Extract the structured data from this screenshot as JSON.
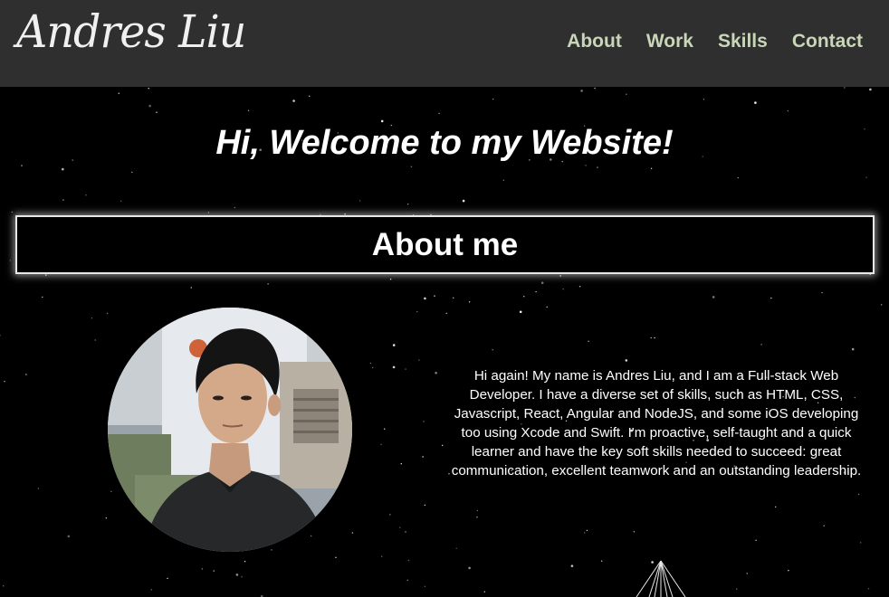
{
  "header": {
    "logo_text": "Andres Liu",
    "nav": [
      "About",
      "Work",
      "Skills",
      "Contact"
    ]
  },
  "hero": {
    "welcome": "Hi, Welcome to my Website!"
  },
  "about": {
    "heading": "About me",
    "bio": "Hi again! My name is Andres Liu, and I am a Full-stack Web Developer. I have a diverse set of skills, such as HTML, CSS, Javascript, React, Angular and NodeJS, and some iOS developing too using Xcode and Swift. I'm proactive, self-taught and a quick learner and have the key soft skills needed to succeed: great communication, excellent teamwork and an outstanding leadership."
  },
  "colors": {
    "header_bg": "#2f2f2f",
    "nav_text": "#c9d6b8",
    "page_bg": "#000000"
  }
}
